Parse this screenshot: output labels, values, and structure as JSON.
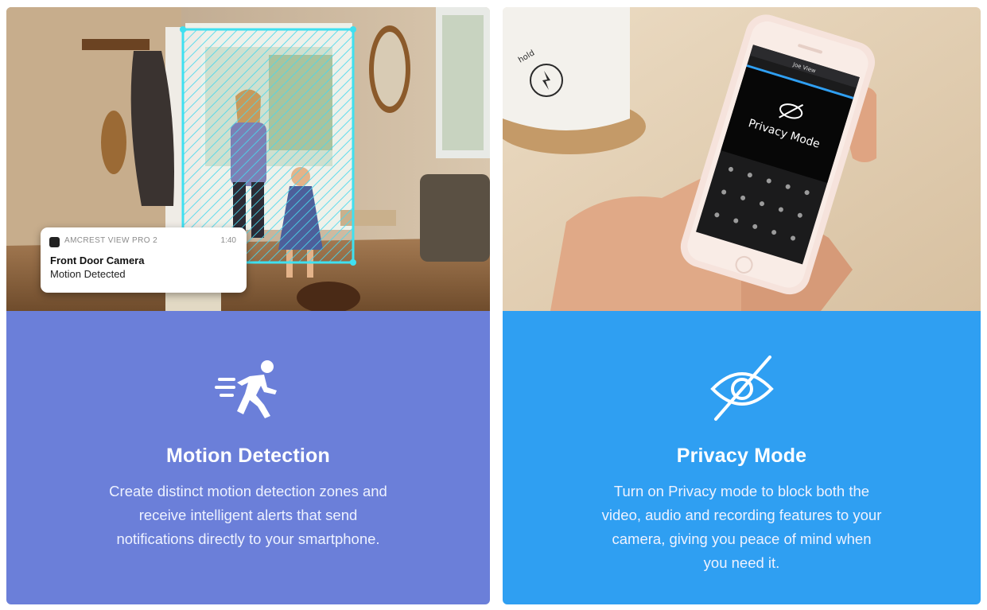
{
  "motion": {
    "title": "Motion Detection",
    "description": "Create distinct motion detection zones and receive intelligent alerts that send notifications directly to your smartphone.",
    "notification": {
      "app_name": "AMCREST VIEW PRO 2",
      "time": "1:40",
      "title": "Front Door Camera",
      "body": "Motion Detected"
    }
  },
  "privacy": {
    "title": "Privacy Mode",
    "description": "Turn on Privacy mode to block both the video, audio and recording features to your camera, giving you peace of mind when you need it.",
    "phone": {
      "header": "Joe View",
      "screen_label": "Privacy Mode"
    },
    "mug_text": "hold"
  },
  "colors": {
    "motion_panel": "#6b7fd9",
    "privacy_panel": "#2f9ff2",
    "detection_zone": "#3fe0f0"
  }
}
